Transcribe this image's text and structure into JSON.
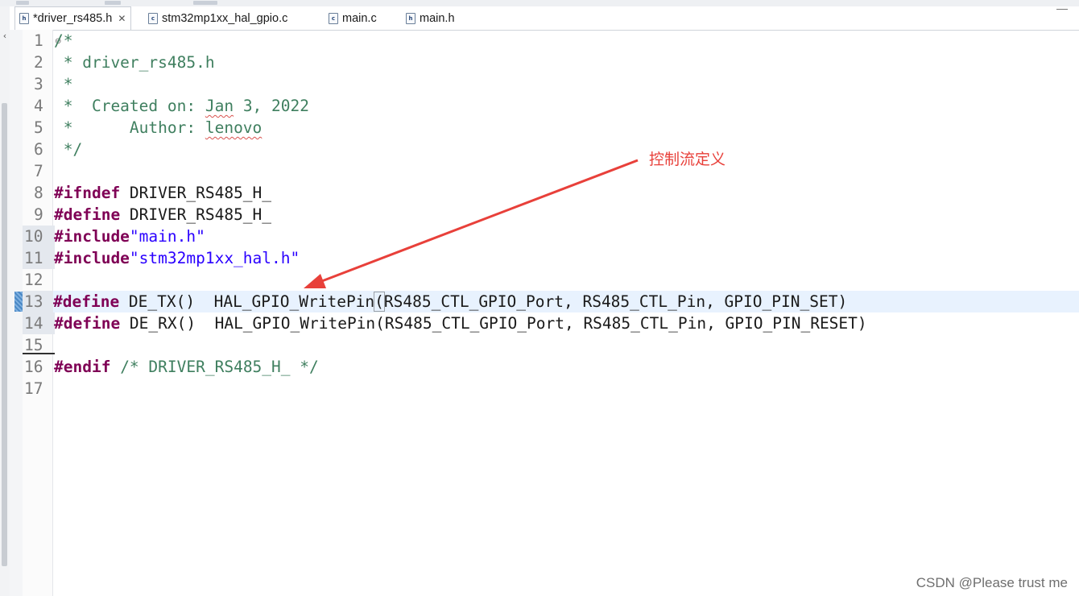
{
  "tabs": [
    {
      "label": "*driver_rs485.h",
      "icon": "h-file-icon",
      "active": true
    },
    {
      "label": "stm32mp1xx_hal_gpio.c",
      "icon": "c-file-icon",
      "active": false
    },
    {
      "label": "main.c",
      "icon": "c-file-icon",
      "active": false
    },
    {
      "label": "main.h",
      "icon": "h-file-icon",
      "active": false
    }
  ],
  "lines": [
    {
      "n": "1",
      "text": "/*"
    },
    {
      "n": "2",
      "text": " * driver_rs485.h"
    },
    {
      "n": "3",
      "text": " *"
    },
    {
      "n": "4",
      "text": " *  Created on: Jan 3, 2022"
    },
    {
      "n": "5",
      "text": " *      Author: lenovo"
    },
    {
      "n": "6",
      "text": " */"
    },
    {
      "n": "7",
      "text": ""
    },
    {
      "n": "8",
      "text": "#ifndef DRIVER_RS485_H_"
    },
    {
      "n": "9",
      "text": "#define DRIVER_RS485_H_"
    },
    {
      "n": "10",
      "text": "#include\"main.h\""
    },
    {
      "n": "11",
      "text": "#include\"stm32mp1xx_hal.h\""
    },
    {
      "n": "12",
      "text": ""
    },
    {
      "n": "13",
      "text": "#define DE_TX()  HAL_GPIO_WritePin(RS485_CTL_GPIO_Port, RS485_CTL_Pin, GPIO_PIN_SET)"
    },
    {
      "n": "14",
      "text": "#define DE_RX()  HAL_GPIO_WritePin(RS485_CTL_GPIO_Port, RS485_CTL_Pin, GPIO_PIN_RESET)"
    },
    {
      "n": "15",
      "text": ""
    },
    {
      "n": "16",
      "text": "#endif /* DRIVER_RS485_H_ */"
    },
    {
      "n": "17",
      "text": ""
    }
  ],
  "tokens": {
    "l2": " * driver_rs485.h",
    "l3": " *",
    "l4a": " *  Created on: ",
    "l4b": "Jan",
    "l4c": " 3, 2022",
    "l5a": " *      Author: ",
    "l5b": "lenovo",
    "l1": "/*",
    "l6": " */",
    "kw_ifndef": "#ifndef",
    "kw_define": "#define",
    "kw_include": "#include",
    "kw_endif": "#endif",
    "ifndef_rest": " DRIVER_RS485_H_",
    "define_rest": " DRIVER_RS485_H_",
    "inc1": "\"main.h\"",
    "inc2": "\"stm32mp1xx_hal.h\"",
    "tx_a": " DE_TX()  HAL_GPIO_WritePin",
    "tx_paren": "(",
    "tx_b": "RS485_CTL_GPIO_Port, RS485_CTL_Pin, GPIO_PIN_SET)",
    "rx_a": " DE_RX()  HAL_GPIO_WritePin(RS485_CTL_GPIO_Port, RS485_CTL_Pin, GPIO_PIN_RESET)",
    "endif_cm": " /* DRIVER_RS485_H_ */"
  },
  "annotation": "控制流定义",
  "watermark": "CSDN @Please trust me",
  "colors": {
    "comment": "#3f7f5f",
    "keyword": "#7f0055",
    "string": "#2a00ff",
    "annotation": "#e8403a",
    "current_line": "#e8f2fe"
  }
}
